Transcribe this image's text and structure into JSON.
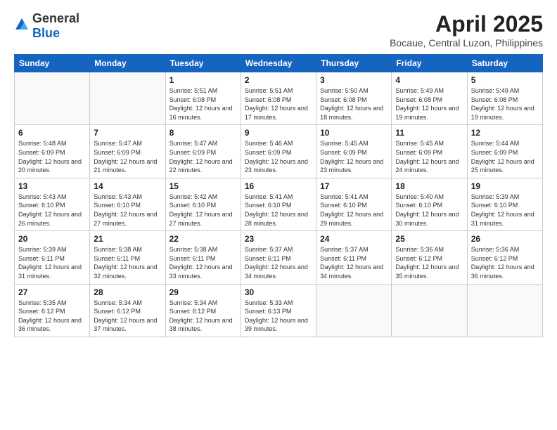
{
  "header": {
    "logo_general": "General",
    "logo_blue": "Blue",
    "title": "April 2025",
    "location": "Bocaue, Central Luzon, Philippines"
  },
  "weekdays": [
    "Sunday",
    "Monday",
    "Tuesday",
    "Wednesday",
    "Thursday",
    "Friday",
    "Saturday"
  ],
  "weeks": [
    [
      {
        "day": "",
        "sunrise": "",
        "sunset": "",
        "daylight": ""
      },
      {
        "day": "",
        "sunrise": "",
        "sunset": "",
        "daylight": ""
      },
      {
        "day": "1",
        "sunrise": "Sunrise: 5:51 AM",
        "sunset": "Sunset: 6:08 PM",
        "daylight": "Daylight: 12 hours and 16 minutes."
      },
      {
        "day": "2",
        "sunrise": "Sunrise: 5:51 AM",
        "sunset": "Sunset: 6:08 PM",
        "daylight": "Daylight: 12 hours and 17 minutes."
      },
      {
        "day": "3",
        "sunrise": "Sunrise: 5:50 AM",
        "sunset": "Sunset: 6:08 PM",
        "daylight": "Daylight: 12 hours and 18 minutes."
      },
      {
        "day": "4",
        "sunrise": "Sunrise: 5:49 AM",
        "sunset": "Sunset: 6:08 PM",
        "daylight": "Daylight: 12 hours and 19 minutes."
      },
      {
        "day": "5",
        "sunrise": "Sunrise: 5:49 AM",
        "sunset": "Sunset: 6:08 PM",
        "daylight": "Daylight: 12 hours and 19 minutes."
      }
    ],
    [
      {
        "day": "6",
        "sunrise": "Sunrise: 5:48 AM",
        "sunset": "Sunset: 6:09 PM",
        "daylight": "Daylight: 12 hours and 20 minutes."
      },
      {
        "day": "7",
        "sunrise": "Sunrise: 5:47 AM",
        "sunset": "Sunset: 6:09 PM",
        "daylight": "Daylight: 12 hours and 21 minutes."
      },
      {
        "day": "8",
        "sunrise": "Sunrise: 5:47 AM",
        "sunset": "Sunset: 6:09 PM",
        "daylight": "Daylight: 12 hours and 22 minutes."
      },
      {
        "day": "9",
        "sunrise": "Sunrise: 5:46 AM",
        "sunset": "Sunset: 6:09 PM",
        "daylight": "Daylight: 12 hours and 23 minutes."
      },
      {
        "day": "10",
        "sunrise": "Sunrise: 5:45 AM",
        "sunset": "Sunset: 6:09 PM",
        "daylight": "Daylight: 12 hours and 23 minutes."
      },
      {
        "day": "11",
        "sunrise": "Sunrise: 5:45 AM",
        "sunset": "Sunset: 6:09 PM",
        "daylight": "Daylight: 12 hours and 24 minutes."
      },
      {
        "day": "12",
        "sunrise": "Sunrise: 5:44 AM",
        "sunset": "Sunset: 6:09 PM",
        "daylight": "Daylight: 12 hours and 25 minutes."
      }
    ],
    [
      {
        "day": "13",
        "sunrise": "Sunrise: 5:43 AM",
        "sunset": "Sunset: 6:10 PM",
        "daylight": "Daylight: 12 hours and 26 minutes."
      },
      {
        "day": "14",
        "sunrise": "Sunrise: 5:43 AM",
        "sunset": "Sunset: 6:10 PM",
        "daylight": "Daylight: 12 hours and 27 minutes."
      },
      {
        "day": "15",
        "sunrise": "Sunrise: 5:42 AM",
        "sunset": "Sunset: 6:10 PM",
        "daylight": "Daylight: 12 hours and 27 minutes."
      },
      {
        "day": "16",
        "sunrise": "Sunrise: 5:41 AM",
        "sunset": "Sunset: 6:10 PM",
        "daylight": "Daylight: 12 hours and 28 minutes."
      },
      {
        "day": "17",
        "sunrise": "Sunrise: 5:41 AM",
        "sunset": "Sunset: 6:10 PM",
        "daylight": "Daylight: 12 hours and 29 minutes."
      },
      {
        "day": "18",
        "sunrise": "Sunrise: 5:40 AM",
        "sunset": "Sunset: 6:10 PM",
        "daylight": "Daylight: 12 hours and 30 minutes."
      },
      {
        "day": "19",
        "sunrise": "Sunrise: 5:39 AM",
        "sunset": "Sunset: 6:10 PM",
        "daylight": "Daylight: 12 hours and 31 minutes."
      }
    ],
    [
      {
        "day": "20",
        "sunrise": "Sunrise: 5:39 AM",
        "sunset": "Sunset: 6:11 PM",
        "daylight": "Daylight: 12 hours and 31 minutes."
      },
      {
        "day": "21",
        "sunrise": "Sunrise: 5:38 AM",
        "sunset": "Sunset: 6:11 PM",
        "daylight": "Daylight: 12 hours and 32 minutes."
      },
      {
        "day": "22",
        "sunrise": "Sunrise: 5:38 AM",
        "sunset": "Sunset: 6:11 PM",
        "daylight": "Daylight: 12 hours and 33 minutes."
      },
      {
        "day": "23",
        "sunrise": "Sunrise: 5:37 AM",
        "sunset": "Sunset: 6:11 PM",
        "daylight": "Daylight: 12 hours and 34 minutes."
      },
      {
        "day": "24",
        "sunrise": "Sunrise: 5:37 AM",
        "sunset": "Sunset: 6:11 PM",
        "daylight": "Daylight: 12 hours and 34 minutes."
      },
      {
        "day": "25",
        "sunrise": "Sunrise: 5:36 AM",
        "sunset": "Sunset: 6:12 PM",
        "daylight": "Daylight: 12 hours and 35 minutes."
      },
      {
        "day": "26",
        "sunrise": "Sunrise: 5:36 AM",
        "sunset": "Sunset: 6:12 PM",
        "daylight": "Daylight: 12 hours and 36 minutes."
      }
    ],
    [
      {
        "day": "27",
        "sunrise": "Sunrise: 5:35 AM",
        "sunset": "Sunset: 6:12 PM",
        "daylight": "Daylight: 12 hours and 36 minutes."
      },
      {
        "day": "28",
        "sunrise": "Sunrise: 5:34 AM",
        "sunset": "Sunset: 6:12 PM",
        "daylight": "Daylight: 12 hours and 37 minutes."
      },
      {
        "day": "29",
        "sunrise": "Sunrise: 5:34 AM",
        "sunset": "Sunset: 6:12 PM",
        "daylight": "Daylight: 12 hours and 38 minutes."
      },
      {
        "day": "30",
        "sunrise": "Sunrise: 5:33 AM",
        "sunset": "Sunset: 6:13 PM",
        "daylight": "Daylight: 12 hours and 39 minutes."
      },
      {
        "day": "",
        "sunrise": "",
        "sunset": "",
        "daylight": ""
      },
      {
        "day": "",
        "sunrise": "",
        "sunset": "",
        "daylight": ""
      },
      {
        "day": "",
        "sunrise": "",
        "sunset": "",
        "daylight": ""
      }
    ]
  ]
}
